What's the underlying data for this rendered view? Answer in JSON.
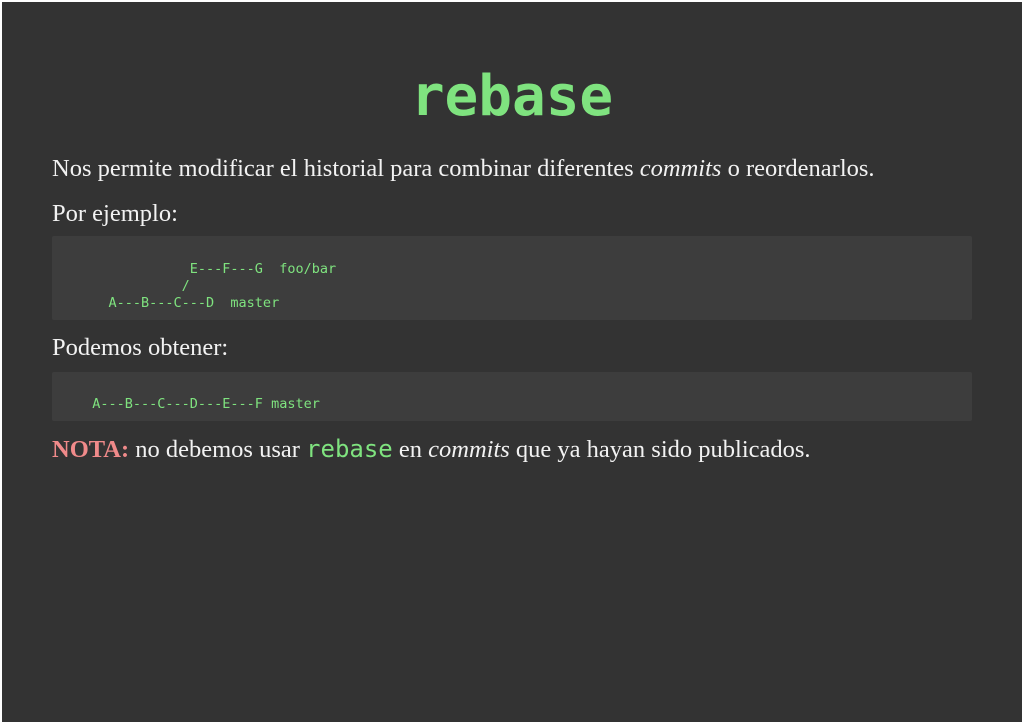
{
  "slide": {
    "title": "rebase",
    "intro": {
      "before": "Nos permite modificar el historial para combinar diferentes ",
      "em": "commits",
      "after": " o reordenarlos."
    },
    "example_label": "Por ejemplo:",
    "code_before": "              E---F---G  foo/bar\n             /\n    A---B---C---D  master",
    "result_label": "Podemos obtener:",
    "code_after": "  A---B---C---D---E---F master",
    "note": {
      "label": "NOTA:",
      "text1": " no debemos usar ",
      "code": "rebase",
      "text2": " en ",
      "em": "commits",
      "text3": " que ya hayan sido publicados."
    }
  }
}
